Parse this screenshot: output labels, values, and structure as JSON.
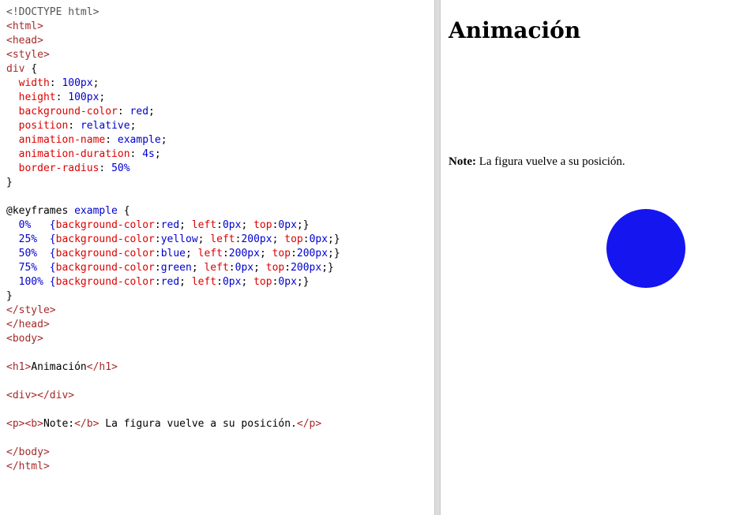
{
  "editor": {
    "line_count": 33,
    "lines": [
      [
        {
          "t": "<!DOCTYPE html>",
          "c": "gray"
        }
      ],
      [
        {
          "t": "<html>",
          "c": "maroon"
        }
      ],
      [
        {
          "t": "<head>",
          "c": "maroon"
        }
      ],
      [
        {
          "t": "<style>",
          "c": "maroon"
        }
      ],
      [
        {
          "t": "div",
          "c": "maroon"
        },
        {
          "t": " {",
          "c": "black"
        }
      ],
      [
        {
          "t": "  width",
          "c": "red"
        },
        {
          "t": ": ",
          "c": "black"
        },
        {
          "t": "100px",
          "c": "blue"
        },
        {
          "t": ";",
          "c": "black"
        }
      ],
      [
        {
          "t": "  height",
          "c": "red"
        },
        {
          "t": ": ",
          "c": "black"
        },
        {
          "t": "100px",
          "c": "blue"
        },
        {
          "t": ";",
          "c": "black"
        }
      ],
      [
        {
          "t": "  background-color",
          "c": "red"
        },
        {
          "t": ": ",
          "c": "black"
        },
        {
          "t": "red",
          "c": "blue"
        },
        {
          "t": ";",
          "c": "black"
        }
      ],
      [
        {
          "t": "  position",
          "c": "red"
        },
        {
          "t": ": ",
          "c": "black"
        },
        {
          "t": "relative",
          "c": "blue"
        },
        {
          "t": ";",
          "c": "black"
        }
      ],
      [
        {
          "t": "  animation-name",
          "c": "red"
        },
        {
          "t": ": ",
          "c": "black"
        },
        {
          "t": "example",
          "c": "blue"
        },
        {
          "t": ";",
          "c": "black"
        }
      ],
      [
        {
          "t": "  animation-duration",
          "c": "red"
        },
        {
          "t": ": ",
          "c": "black"
        },
        {
          "t": "4s",
          "c": "blue"
        },
        {
          "t": ";",
          "c": "black"
        }
      ],
      [
        {
          "t": "  border-radius",
          "c": "red"
        },
        {
          "t": ": ",
          "c": "black"
        },
        {
          "t": "50%",
          "c": "blue"
        }
      ],
      [
        {
          "t": "}",
          "c": "black"
        }
      ],
      [
        {
          "t": "",
          "c": "black"
        }
      ],
      [
        {
          "t": "@keyframes ",
          "c": "black"
        },
        {
          "t": "example",
          "c": "blue"
        },
        {
          "t": " {",
          "c": "black"
        }
      ],
      [
        {
          "t": "  0%   {",
          "c": "blue"
        },
        {
          "t": "background-color",
          "c": "red"
        },
        {
          "t": ":",
          "c": "black"
        },
        {
          "t": "red",
          "c": "blue"
        },
        {
          "t": "; ",
          "c": "black"
        },
        {
          "t": "left",
          "c": "red"
        },
        {
          "t": ":",
          "c": "black"
        },
        {
          "t": "0px",
          "c": "blue"
        },
        {
          "t": "; ",
          "c": "black"
        },
        {
          "t": "top",
          "c": "red"
        },
        {
          "t": ":",
          "c": "black"
        },
        {
          "t": "0px",
          "c": "blue"
        },
        {
          "t": ";}",
          "c": "black"
        }
      ],
      [
        {
          "t": "  25%  {",
          "c": "blue"
        },
        {
          "t": "background-color",
          "c": "red"
        },
        {
          "t": ":",
          "c": "black"
        },
        {
          "t": "yellow",
          "c": "blue"
        },
        {
          "t": "; ",
          "c": "black"
        },
        {
          "t": "left",
          "c": "red"
        },
        {
          "t": ":",
          "c": "black"
        },
        {
          "t": "200px",
          "c": "blue"
        },
        {
          "t": "; ",
          "c": "black"
        },
        {
          "t": "top",
          "c": "red"
        },
        {
          "t": ":",
          "c": "black"
        },
        {
          "t": "0px",
          "c": "blue"
        },
        {
          "t": ";}",
          "c": "black"
        }
      ],
      [
        {
          "t": "  50%  {",
          "c": "blue"
        },
        {
          "t": "background-color",
          "c": "red"
        },
        {
          "t": ":",
          "c": "black"
        },
        {
          "t": "blue",
          "c": "blue"
        },
        {
          "t": "; ",
          "c": "black"
        },
        {
          "t": "left",
          "c": "red"
        },
        {
          "t": ":",
          "c": "black"
        },
        {
          "t": "200px",
          "c": "blue"
        },
        {
          "t": "; ",
          "c": "black"
        },
        {
          "t": "top",
          "c": "red"
        },
        {
          "t": ":",
          "c": "black"
        },
        {
          "t": "200px",
          "c": "blue"
        },
        {
          "t": ";}",
          "c": "black"
        }
      ],
      [
        {
          "t": "  75%  {",
          "c": "blue"
        },
        {
          "t": "background-color",
          "c": "red"
        },
        {
          "t": ":",
          "c": "black"
        },
        {
          "t": "green",
          "c": "blue"
        },
        {
          "t": "; ",
          "c": "black"
        },
        {
          "t": "left",
          "c": "red"
        },
        {
          "t": ":",
          "c": "black"
        },
        {
          "t": "0px",
          "c": "blue"
        },
        {
          "t": "; ",
          "c": "black"
        },
        {
          "t": "top",
          "c": "red"
        },
        {
          "t": ":",
          "c": "black"
        },
        {
          "t": "200px",
          "c": "blue"
        },
        {
          "t": ";}",
          "c": "black"
        }
      ],
      [
        {
          "t": "  100% {",
          "c": "blue"
        },
        {
          "t": "background-color",
          "c": "red"
        },
        {
          "t": ":",
          "c": "black"
        },
        {
          "t": "red",
          "c": "blue"
        },
        {
          "t": "; ",
          "c": "black"
        },
        {
          "t": "left",
          "c": "red"
        },
        {
          "t": ":",
          "c": "black"
        },
        {
          "t": "0px",
          "c": "blue"
        },
        {
          "t": "; ",
          "c": "black"
        },
        {
          "t": "top",
          "c": "red"
        },
        {
          "t": ":",
          "c": "black"
        },
        {
          "t": "0px",
          "c": "blue"
        },
        {
          "t": ";}",
          "c": "black"
        }
      ],
      [
        {
          "t": "}",
          "c": "black"
        }
      ],
      [
        {
          "t": "</style>",
          "c": "maroon"
        }
      ],
      [
        {
          "t": "</head>",
          "c": "maroon"
        }
      ],
      [
        {
          "t": "<body>",
          "c": "maroon"
        }
      ],
      [
        {
          "t": "",
          "c": "black"
        }
      ],
      [
        {
          "t": "<h1>",
          "c": "maroon"
        },
        {
          "t": "Animación",
          "c": "black"
        },
        {
          "t": "</h1>",
          "c": "maroon"
        }
      ],
      [
        {
          "t": "",
          "c": "black"
        }
      ],
      [
        {
          "t": "<div></div>",
          "c": "maroon"
        }
      ],
      [
        {
          "t": "",
          "c": "black"
        }
      ],
      [
        {
          "t": "<p><b>",
          "c": "maroon"
        },
        {
          "t": "Note:",
          "c": "black"
        },
        {
          "t": "</b>",
          "c": "maroon"
        },
        {
          "t": " La figura vuelve a su posición.",
          "c": "black"
        },
        {
          "t": "</p>",
          "c": "maroon"
        }
      ],
      [
        {
          "t": "",
          "c": "black"
        }
      ],
      [
        {
          "t": "</body>",
          "c": "maroon"
        }
      ],
      [
        {
          "t": "</html>",
          "c": "maroon"
        }
      ]
    ]
  },
  "syntax_colors": {
    "gray": "#555555",
    "maroon": "#a52a2a",
    "red": "#dd0000",
    "blue": "#0000cd",
    "black": "#000000"
  },
  "result": {
    "title": "Animación",
    "note_bold": "Note:",
    "note_text": " La figura vuelve a su posición.",
    "circle_color": "#1515f0"
  }
}
